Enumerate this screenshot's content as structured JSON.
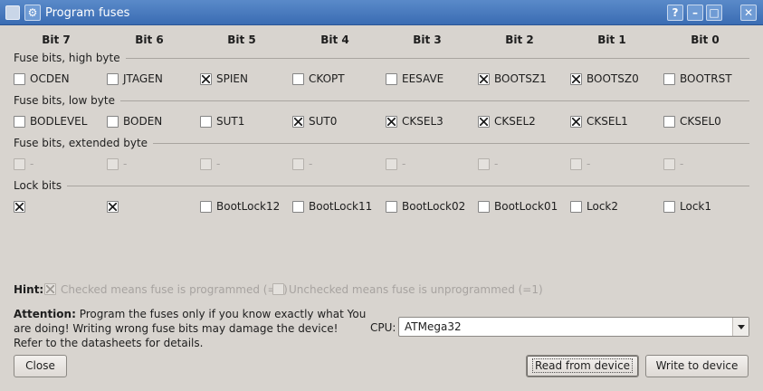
{
  "window": {
    "title": "Program fuses",
    "help_label": "?",
    "minimize_label": "–",
    "maximize_label": "□",
    "close_label": "✕"
  },
  "columns": [
    "Bit 7",
    "Bit 6",
    "Bit 5",
    "Bit 4",
    "Bit 3",
    "Bit 2",
    "Bit 1",
    "Bit 0"
  ],
  "sections": [
    {
      "title": "Fuse bits, high byte",
      "bits": [
        {
          "label": "OCDEN",
          "checked": false,
          "enabled": true
        },
        {
          "label": "JTAGEN",
          "checked": false,
          "enabled": true
        },
        {
          "label": "SPIEN",
          "checked": true,
          "enabled": true
        },
        {
          "label": "CKOPT",
          "checked": false,
          "enabled": true
        },
        {
          "label": "EESAVE",
          "checked": false,
          "enabled": true
        },
        {
          "label": "BOOTSZ1",
          "checked": true,
          "enabled": true
        },
        {
          "label": "BOOTSZ0",
          "checked": true,
          "enabled": true
        },
        {
          "label": "BOOTRST",
          "checked": false,
          "enabled": true
        }
      ]
    },
    {
      "title": "Fuse bits, low byte",
      "bits": [
        {
          "label": "BODLEVEL",
          "checked": false,
          "enabled": true
        },
        {
          "label": "BODEN",
          "checked": false,
          "enabled": true
        },
        {
          "label": "SUT1",
          "checked": false,
          "enabled": true
        },
        {
          "label": "SUT0",
          "checked": true,
          "enabled": true
        },
        {
          "label": "CKSEL3",
          "checked": true,
          "enabled": true
        },
        {
          "label": "CKSEL2",
          "checked": true,
          "enabled": true
        },
        {
          "label": "CKSEL1",
          "checked": true,
          "enabled": true
        },
        {
          "label": "CKSEL0",
          "checked": false,
          "enabled": true
        }
      ]
    },
    {
      "title": "Fuse bits, extended byte",
      "bits": [
        {
          "label": "-",
          "checked": false,
          "enabled": false
        },
        {
          "label": "-",
          "checked": false,
          "enabled": false
        },
        {
          "label": "-",
          "checked": false,
          "enabled": false
        },
        {
          "label": "-",
          "checked": false,
          "enabled": false
        },
        {
          "label": "-",
          "checked": false,
          "enabled": false
        },
        {
          "label": "-",
          "checked": false,
          "enabled": false
        },
        {
          "label": "-",
          "checked": false,
          "enabled": false
        },
        {
          "label": "-",
          "checked": false,
          "enabled": false
        }
      ]
    },
    {
      "title": "Lock bits",
      "bits": [
        {
          "label": "",
          "checked": true,
          "enabled": true
        },
        {
          "label": "",
          "checked": true,
          "enabled": true
        },
        {
          "label": "BootLock12",
          "checked": false,
          "enabled": true
        },
        {
          "label": "BootLock11",
          "checked": false,
          "enabled": true
        },
        {
          "label": "BootLock02",
          "checked": false,
          "enabled": true
        },
        {
          "label": "BootLock01",
          "checked": false,
          "enabled": true
        },
        {
          "label": "Lock2",
          "checked": false,
          "enabled": true
        },
        {
          "label": "Lock1",
          "checked": false,
          "enabled": true
        }
      ]
    }
  ],
  "hint": {
    "label": "Hint:",
    "checked_text": "Checked means fuse is programmed (=0)",
    "unchecked_text": "Unchecked means fuse is unprogrammed (=1)"
  },
  "attention": {
    "bold": "Attention:",
    "text": "Program the fuses only if you know exactly what You are doing! Writing wrong fuse bits may damage the device! Refer to the datasheets for details."
  },
  "cpu": {
    "label": "CPU:",
    "value": "ATMega32"
  },
  "buttons": {
    "close": "Close",
    "read": "Read from device",
    "write": "Write to device"
  }
}
